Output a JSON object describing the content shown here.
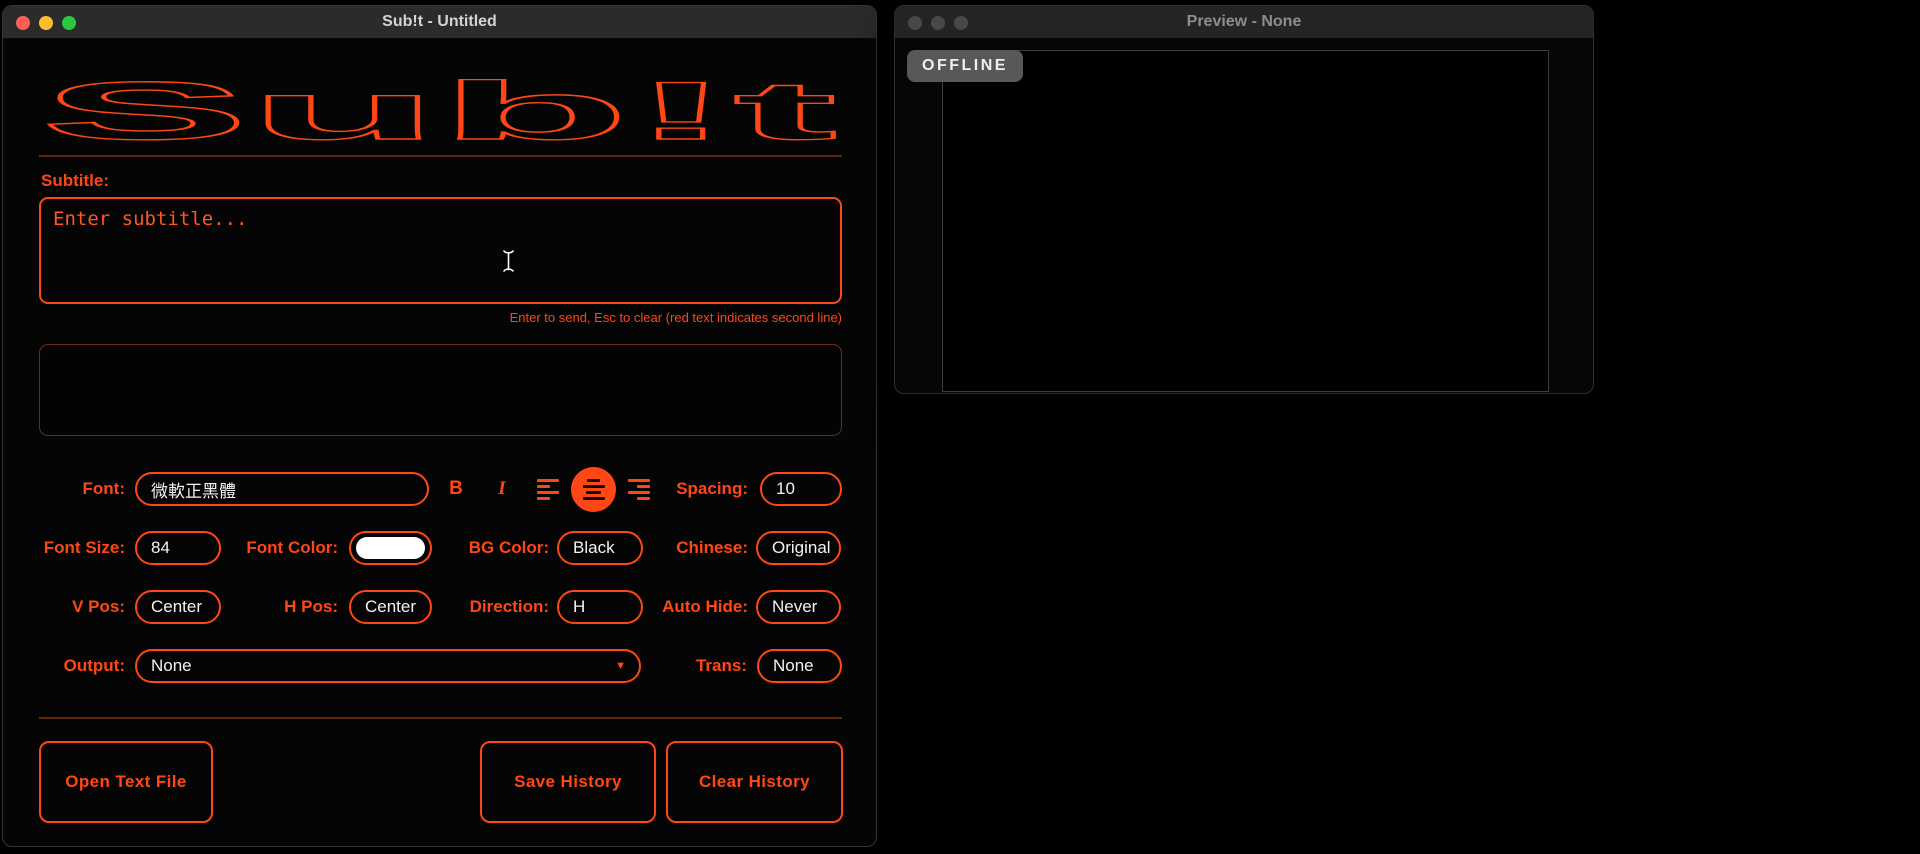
{
  "colors": {
    "accent": "#ff4716",
    "font_color_swatch": "#ffffff"
  },
  "main_window": {
    "title": "Sub!t - Untitled",
    "logo": "Sub!t",
    "subtitle": {
      "label": "Subtitle:",
      "placeholder": "Enter subtitle...",
      "helper": "Enter to send, Esc to clear (red text indicates second line)"
    },
    "controls": {
      "font": {
        "label": "Font:",
        "value": "微軟正黑體"
      },
      "bold": "B",
      "italic": "I",
      "spacing": {
        "label": "Spacing:",
        "value": "10"
      },
      "font_size": {
        "label": "Font Size:",
        "value": "84"
      },
      "font_color": {
        "label": "Font Color:",
        "value": "#ffffff"
      },
      "bg_color": {
        "label": "BG Color:",
        "value": "Black"
      },
      "chinese": {
        "label": "Chinese:",
        "value": "Original"
      },
      "v_pos": {
        "label": "V Pos:",
        "value": "Center"
      },
      "h_pos": {
        "label": "H Pos:",
        "value": "Center"
      },
      "direction": {
        "label": "Direction:",
        "value": "H"
      },
      "auto_hide": {
        "label": "Auto Hide:",
        "value": "Never"
      },
      "output": {
        "label": "Output:",
        "value": "None"
      },
      "trans": {
        "label": "Trans:",
        "value": "None"
      }
    },
    "buttons": {
      "open_text_file": "Open Text File",
      "save_history": "Save History",
      "clear_history": "Clear History"
    }
  },
  "preview_window": {
    "title": "Preview - None",
    "status_badge": "OFFLINE"
  }
}
